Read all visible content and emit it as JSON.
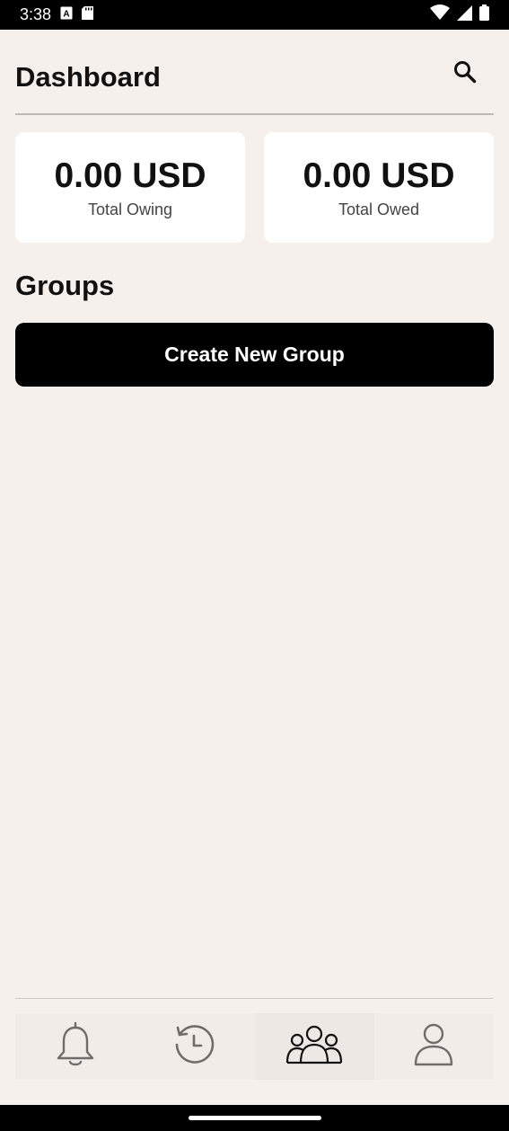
{
  "status_bar": {
    "time": "3:38"
  },
  "header": {
    "title": "Dashboard"
  },
  "summary": {
    "owing": {
      "amount": "0.00 USD",
      "label": "Total Owing"
    },
    "owed": {
      "amount": "0.00 USD",
      "label": "Total Owed"
    }
  },
  "groups": {
    "title": "Groups",
    "create_label": "Create New Group"
  },
  "bottom_nav": {
    "items": [
      {
        "icon": "bell-icon",
        "active": false
      },
      {
        "icon": "history-icon",
        "active": false
      },
      {
        "icon": "group-icon",
        "active": true
      },
      {
        "icon": "user-icon",
        "active": false
      }
    ]
  },
  "colors": {
    "background": "#f5f0ec",
    "card": "#ffffff",
    "primary_button": "#000000",
    "inactive_icon": "#6f6c6a",
    "active_icon": "#111111"
  }
}
